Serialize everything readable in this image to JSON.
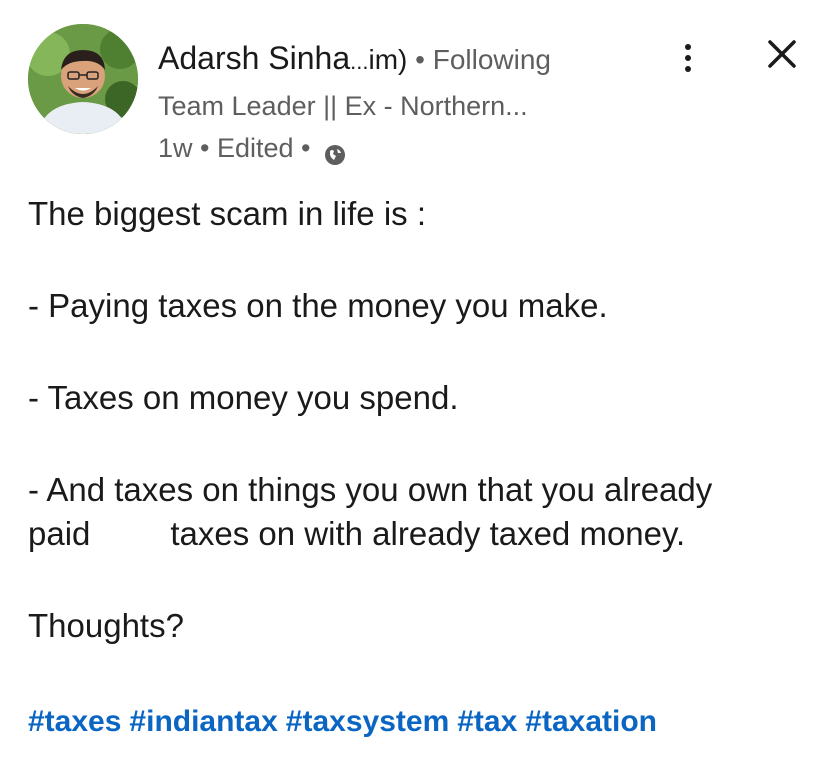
{
  "author": {
    "name": "Adarsh Sinha",
    "name_truncation": "...",
    "name_suffix": "im)",
    "separator": " • ",
    "follow_status": "Following",
    "headline": "Team Leader || Ex - Northern...",
    "posted_time": "1w",
    "edited_label": "Edited",
    "visibility_icon": "globe-icon"
  },
  "actions": {
    "more_icon": "more-vertical-icon",
    "close_icon": "close-icon"
  },
  "post": {
    "line1": "The biggest scam in life is :",
    "line2": "- Paying taxes on the money you make.",
    "line3": "- Taxes on money you spend.",
    "line4a": "- And taxes on things you own that you already",
    "line4b_part1": "paid",
    "line4b_part2": "taxes on with already taxed money.",
    "line5": "Thoughts?"
  },
  "hashtags": [
    "#taxes",
    "#indiantax",
    "#taxsystem",
    "#tax",
    "#taxation"
  ],
  "colors": {
    "hashtag": "#0a66c2",
    "secondary_text": "#5e5e5e",
    "primary_text": "#1a1a1a"
  }
}
